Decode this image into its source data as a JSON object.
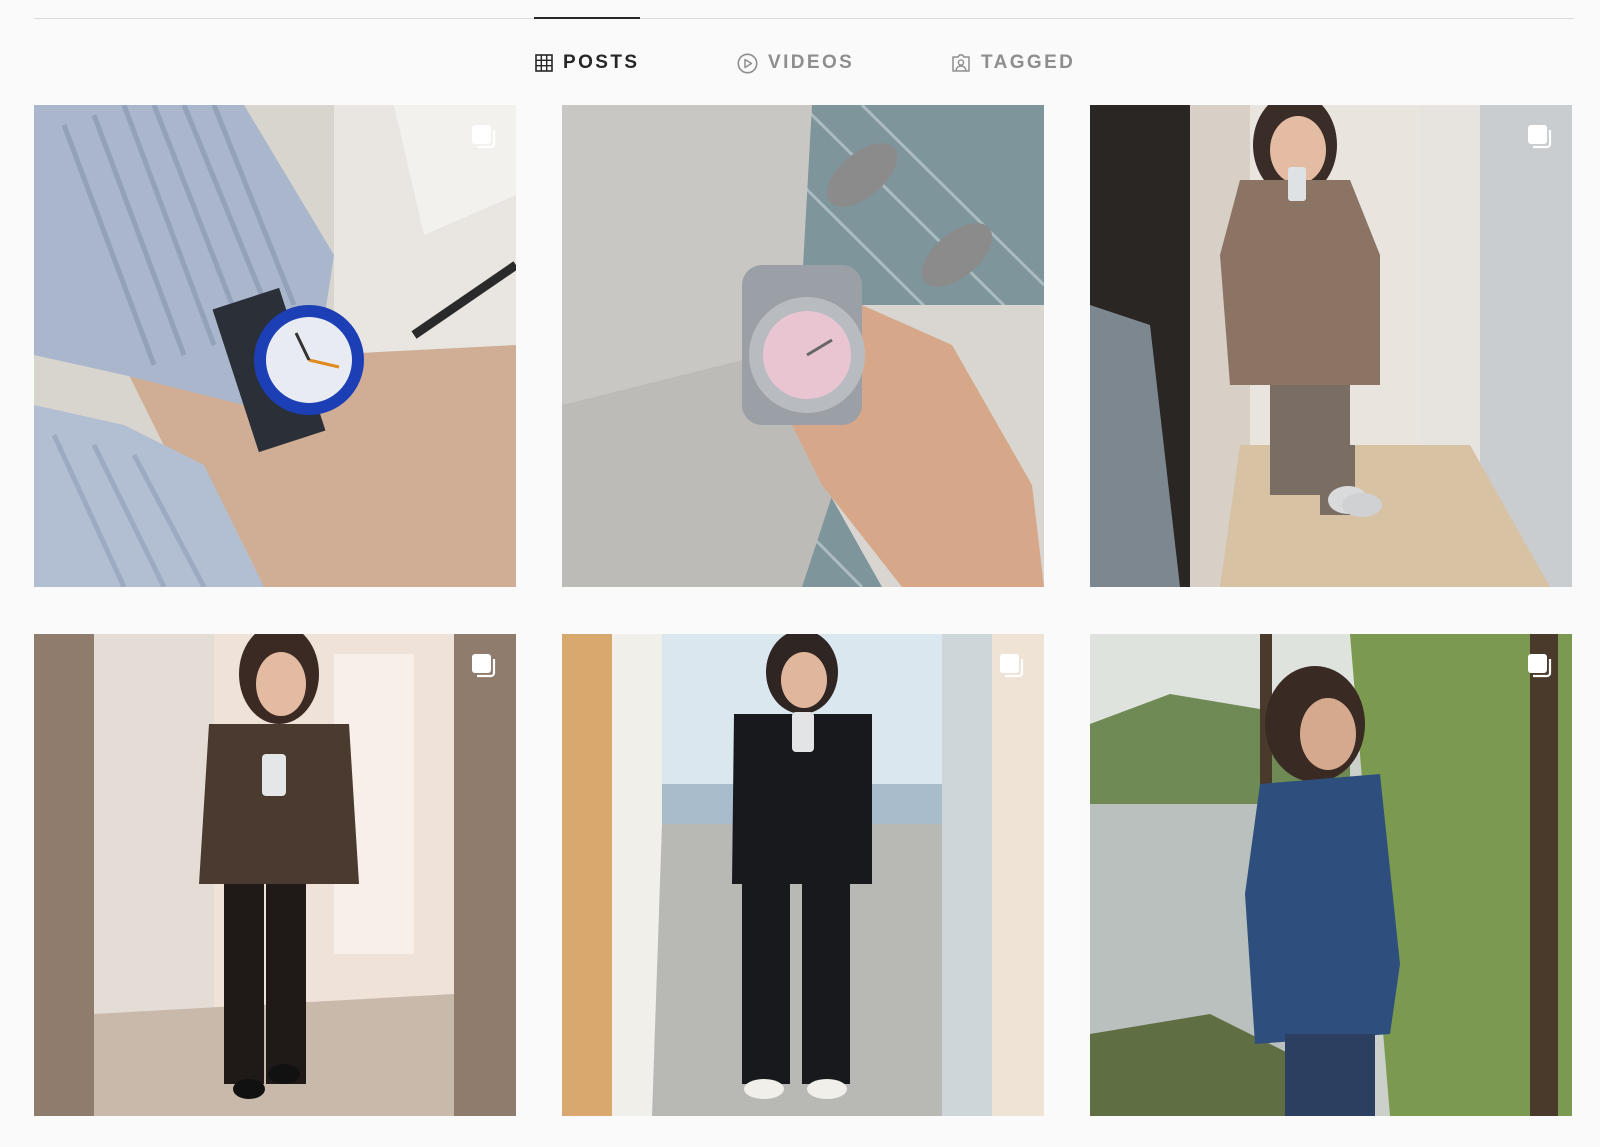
{
  "tabs": [
    {
      "label": "POSTS",
      "icon": "grid-icon",
      "active": true
    },
    {
      "label": "VIDEOS",
      "icon": "play-icon",
      "active": false
    },
    {
      "label": "TAGGED",
      "icon": "tag-person-icon",
      "active": false
    }
  ],
  "posts": [
    {
      "subject": "wrist with blue watch and light blue sweater",
      "multi": true
    },
    {
      "subject": "wrist with steel watch with pink dial, grey sweatshirt",
      "multi": false
    },
    {
      "subject": "mirror selfie in brown cardigan",
      "multi": true
    },
    {
      "subject": "mirror selfie in tweed blazer",
      "multi": true
    },
    {
      "subject": "mirror selfie in black overalls",
      "multi": true
    },
    {
      "subject": "woman in denim jacket by a lake",
      "multi": true
    }
  ],
  "colors": {
    "background": "#fafafa",
    "active_tab": "#262626",
    "inactive_tab": "#8e8e8e",
    "divider": "#dbdbdb"
  }
}
